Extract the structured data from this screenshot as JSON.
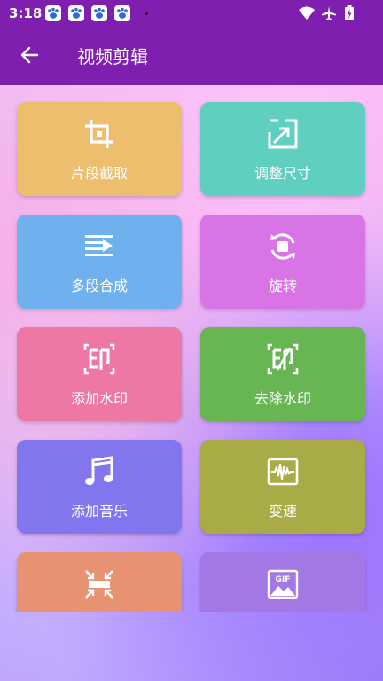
{
  "status_bar": {
    "time": "3:18"
  },
  "header": {
    "title": "视频剪辑"
  },
  "tiles": [
    {
      "label": "片段截取",
      "icon": "crop-icon",
      "color": "#edbe6d"
    },
    {
      "label": "调整尺寸",
      "icon": "resize-icon",
      "color": "#5fcfc0"
    },
    {
      "label": "多段合成",
      "icon": "merge-segments-icon",
      "color": "#6fb0ee"
    },
    {
      "label": "旋转",
      "icon": "rotate-icon",
      "color": "#d874e6"
    },
    {
      "label": "添加水印",
      "icon": "add-watermark-icon",
      "color": "#ec78a3"
    },
    {
      "label": "去除水印",
      "icon": "remove-watermark-icon",
      "color": "#68b553"
    },
    {
      "label": "添加音乐",
      "icon": "music-note-icon",
      "color": "#8276ee"
    },
    {
      "label": "变速",
      "icon": "speed-waveform-icon",
      "color": "#a9ac46"
    },
    {
      "label": "",
      "icon": "compress-icon",
      "color": "#e89274"
    },
    {
      "label": "",
      "icon": "gif-icon",
      "color": "#a377e4"
    }
  ]
}
